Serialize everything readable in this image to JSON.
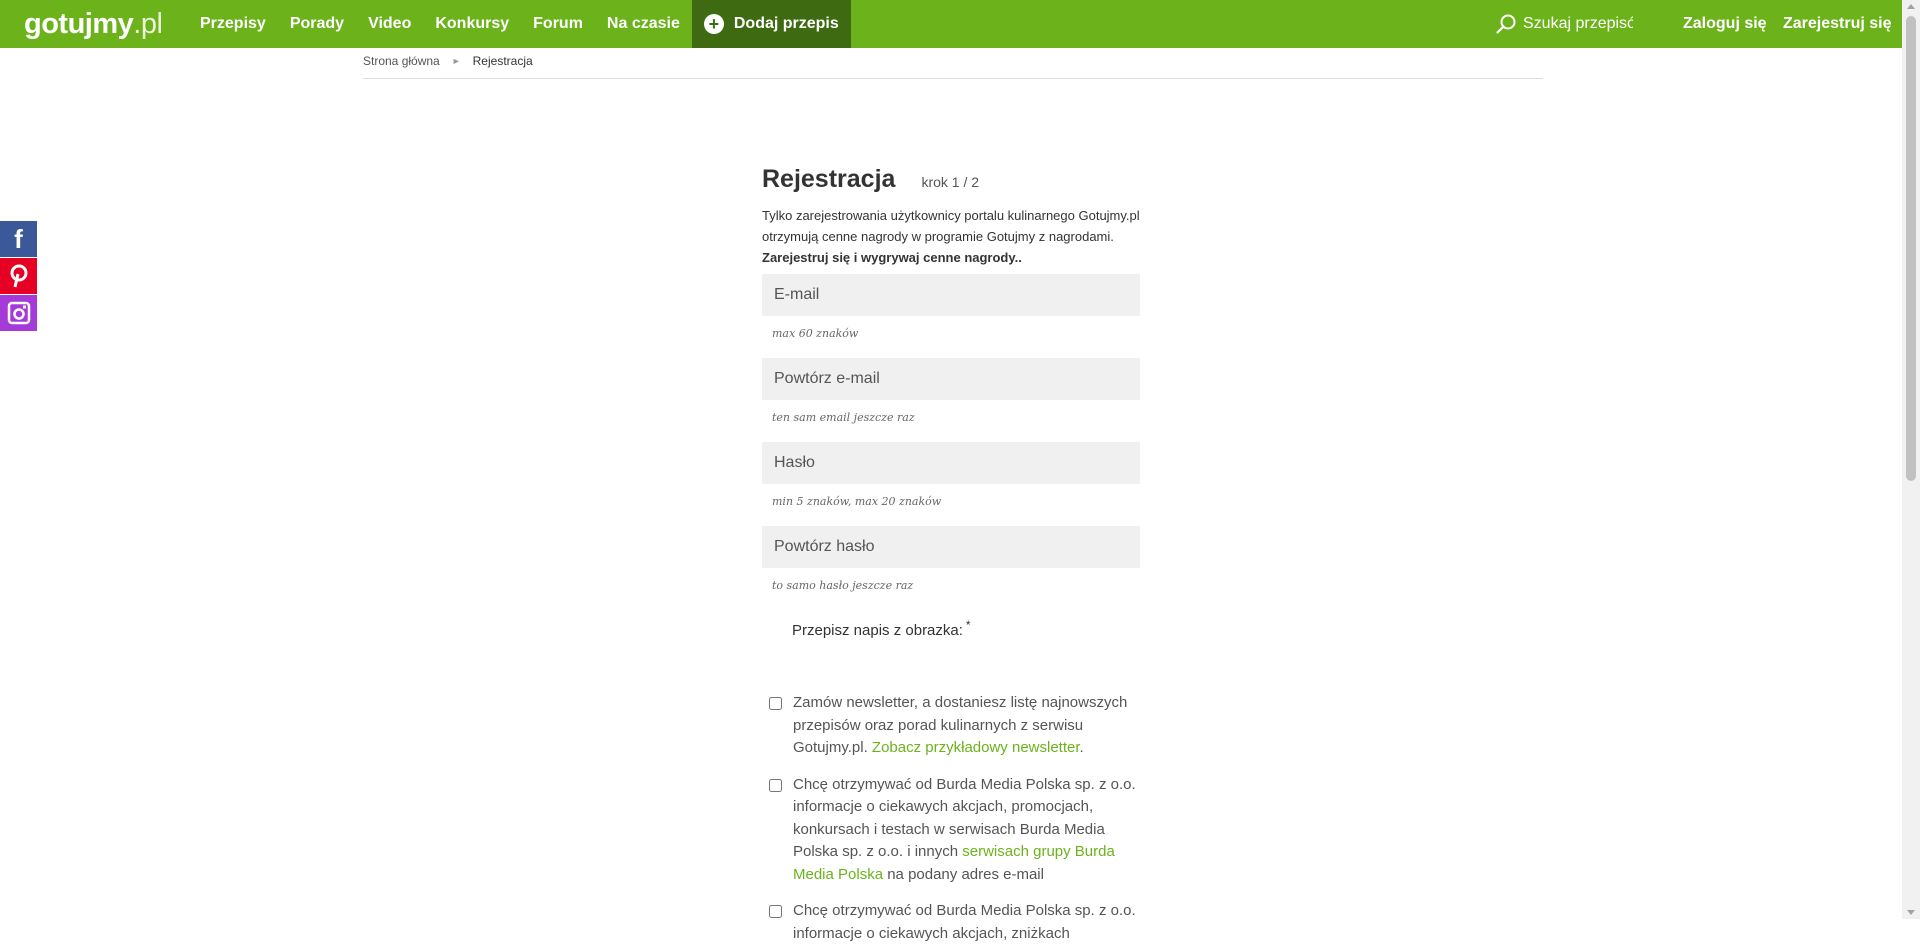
{
  "header": {
    "logo_main": "gotujmy",
    "logo_suffix": ".pl",
    "nav": [
      "Przepisy",
      "Porady",
      "Video",
      "Konkursy",
      "Forum",
      "Na czasie"
    ],
    "add_recipe": "Dodaj przepis",
    "search_placeholder": "Szukaj przepisów",
    "login": "Zaloguj się",
    "register": "Zarejestruj się",
    "accent_color": "#6cb31b"
  },
  "breadcrumb": {
    "home": "Strona główna",
    "current": "Rejestracja"
  },
  "social": [
    "facebook-icon",
    "pinterest-icon",
    "instagram-icon"
  ],
  "form": {
    "title": "Rejestracja",
    "step": "krok 1 / 2",
    "intro_plain": "Tylko zarejestrowania użytkownicy portalu kulinarnego Gotujmy.pl otrzymują cenne nagrody w programie Gotujmy z nagrodami. ",
    "intro_bold": "Zarejestruj się i wygrywaj cenne nagrody..",
    "fields": [
      {
        "placeholder": "E-mail",
        "hint": "max 60 znaków"
      },
      {
        "placeholder": "Powtórz e-mail",
        "hint": "ten sam email jeszcze raz"
      },
      {
        "placeholder": "Hasło",
        "hint": "min 5 znaków, max 20 znaków"
      },
      {
        "placeholder": "Powtórz hasło",
        "hint": "to samo hasło jeszcze raz"
      }
    ],
    "captcha_label": "Przepisz napis z obrazka:",
    "captcha_required": "*",
    "newsletter_text": "Zamów newsletter, a dostaniesz listę najnowszych przepisów oraz porad kulinarnych z serwisu Gotujmy.pl. ",
    "newsletter_link": "Zobacz przykładowy newsletter",
    "newsletter_end": ".",
    "consent1_text": "Chcę otrzymywać od Burda Media Polska sp. z o.o. informacje o ciekawych akcjach, promocjach, konkursach i testach w serwisach Burda Media Polska sp. z o.o. i innych ",
    "consent1_link": "serwisach grupy Burda Media Polska",
    "consent1_end": " na podany adres e-mail",
    "consent2_text": "Chcę otrzymywać od Burda Media Polska sp. z o.o. informacje o ciekawych akcjach, zniżkach"
  }
}
